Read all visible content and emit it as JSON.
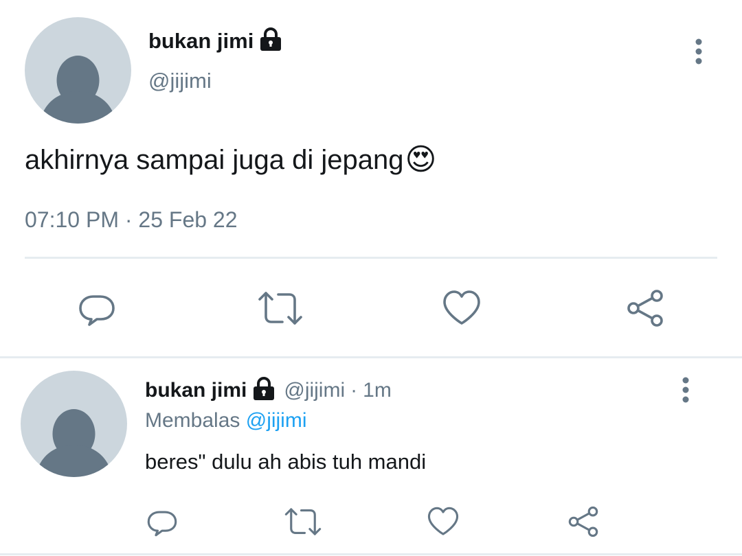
{
  "main_tweet": {
    "display_name": "bukan jimi",
    "handle": "@jijimi",
    "text": "akhirnya sampai juga di jepang",
    "emoji": "😍",
    "time": "07:10 PM",
    "separator": "·",
    "date": "25 Feb 22"
  },
  "reply_tweet": {
    "display_name": "bukan jimi",
    "handle": "@jijimi",
    "separator": "·",
    "age": "1m",
    "replying_to_label": "Membalas",
    "replying_to_handle": "@jijimi",
    "text": "beres\" dulu ah abis tuh mandi"
  },
  "actions": [
    "reply-icon",
    "retweet-icon",
    "like-icon",
    "share-icon"
  ],
  "colors": {
    "icon": "#657786",
    "link": "#1da1f2",
    "divider": "#e6ecf0",
    "avatar_bg": "#ccd6dd",
    "avatar_fg": "#657786"
  }
}
